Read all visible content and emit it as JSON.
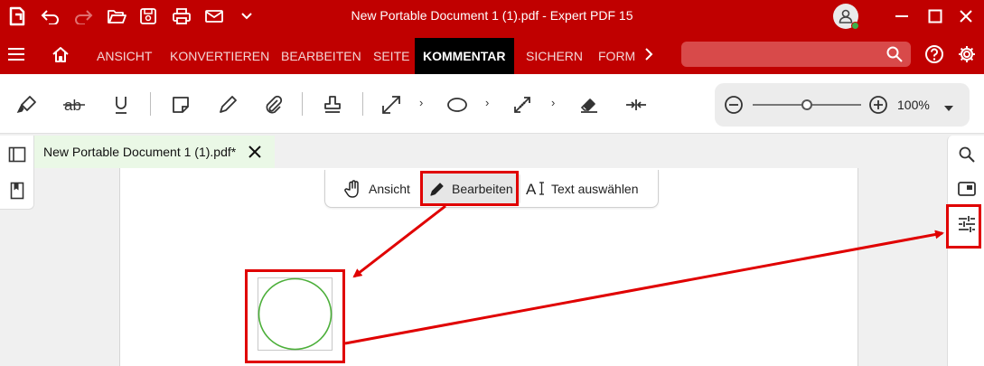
{
  "window": {
    "title": "New Portable Document 1 (1).pdf  -  Expert PDF 15"
  },
  "quick_access": [
    "app-logo-icon",
    "undo-icon",
    "redo-icon",
    "open-folder-icon",
    "save-icon",
    "print-icon",
    "mail-icon",
    "chevron-down-icon"
  ],
  "ribbon": {
    "tabs": [
      "ANSICHT",
      "KONVERTIEREN",
      "BEARBEITEN",
      "SEITE",
      "KOMMENTAR",
      "SICHERN",
      "FORM"
    ],
    "active_tab": "KOMMENTAR",
    "search_placeholder": ""
  },
  "zoom": {
    "label": "100%",
    "level_percent": 100
  },
  "document_tab": {
    "label": "New Portable Document 1 (1).pdf*"
  },
  "modes": {
    "view_label": "Ansicht",
    "edit_label": "Bearbeiten",
    "select_label": "Text auswählen",
    "selected": "Bearbeiten"
  },
  "colors": {
    "brand_red": "#c00000",
    "active_tab": "#000000",
    "highlight_red": "#e00000",
    "circle_green": "#4caf3a",
    "doc_tab_bg": "#eaf8e6"
  }
}
